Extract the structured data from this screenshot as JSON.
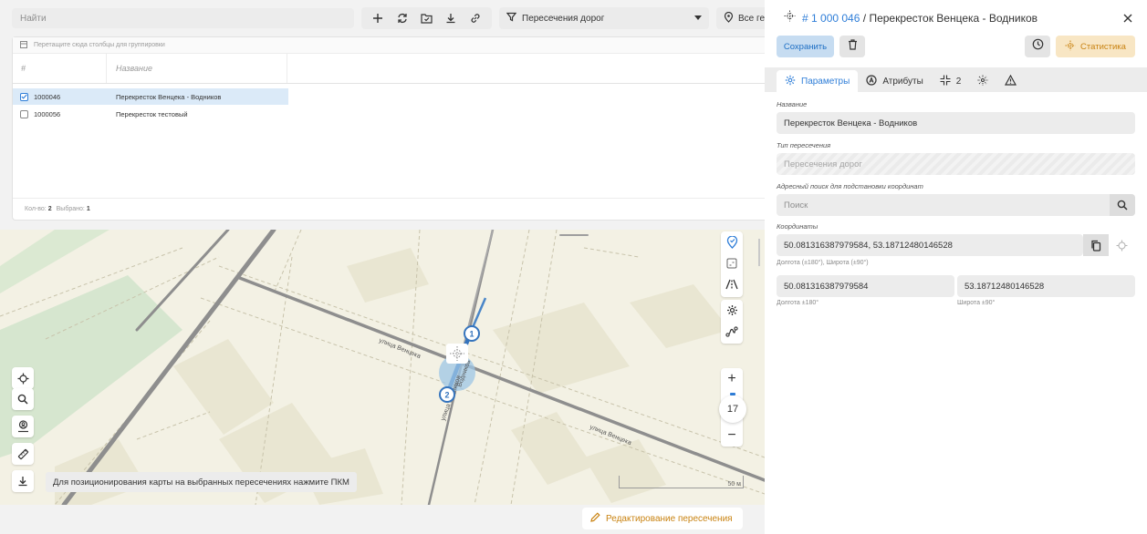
{
  "toolbar": {
    "search_placeholder": "Найти",
    "filter_select": "Пересечения дорог",
    "scope_select": "Все ге",
    "icons": [
      "plus-icon",
      "refresh-icon",
      "folder-check-icon",
      "download-icon",
      "link-icon",
      "filter-icon",
      "chevron-down-icon",
      "pin-icon"
    ]
  },
  "table": {
    "group_hint": "Перетащите сюда столбцы для группировки",
    "columns": [
      "#",
      "Название"
    ],
    "rows": [
      {
        "id": "1000046",
        "name": "Перекресток Венцека - Водников",
        "selected": true
      },
      {
        "id": "1000056",
        "name": "Перекресток тестовый",
        "selected": false
      }
    ],
    "footer": {
      "count_label": "Кол-во:",
      "count": "2",
      "selected_label": "Выбрано:",
      "selected": "1"
    }
  },
  "map": {
    "street_labels": [
      "улица Венцека",
      "улица Венцека",
      "Водников",
      "улица Водников"
    ],
    "markers": [
      "1",
      "2"
    ],
    "zoom_level": "17",
    "scale_label": "50 м",
    "tooltip": "Для позиционирования карты на выбранных пересечениях нажмите ПКМ",
    "edit_button": "Редактирование пересечения"
  },
  "panel": {
    "title_number": "# 1 000 046",
    "title_separator": "/",
    "title_name": "Перекресток Венцека - Водников",
    "save_label": "Сохранить",
    "stats_label": "Статистика",
    "tabs": {
      "params": "Параметры",
      "attributes": "Атрибуты",
      "count": "2"
    },
    "fields": {
      "name_label": "Название",
      "name_value": "Перекресток Венцека - Водников",
      "type_label": "Тип пересечения",
      "type_value": "Пересечения дорог",
      "address_label": "Адресный поиск для подстановки координат",
      "address_placeholder": "Поиск",
      "coords_label": "Координаты",
      "coords_value": "50.081316387979584, 53.18712480146528",
      "coords_hint": "Долгота (±180°), Широта (±90°)",
      "lon_value": "50.081316387979584",
      "lon_hint": "Долгота ±180°",
      "lat_value": "53.18712480146528",
      "lat_hint": "Широта ±90°"
    }
  },
  "colors": {
    "accent": "#2f7ed8",
    "warning": "#c98312",
    "map_background": "#f3f1e4",
    "park": "#d6e6cf"
  }
}
